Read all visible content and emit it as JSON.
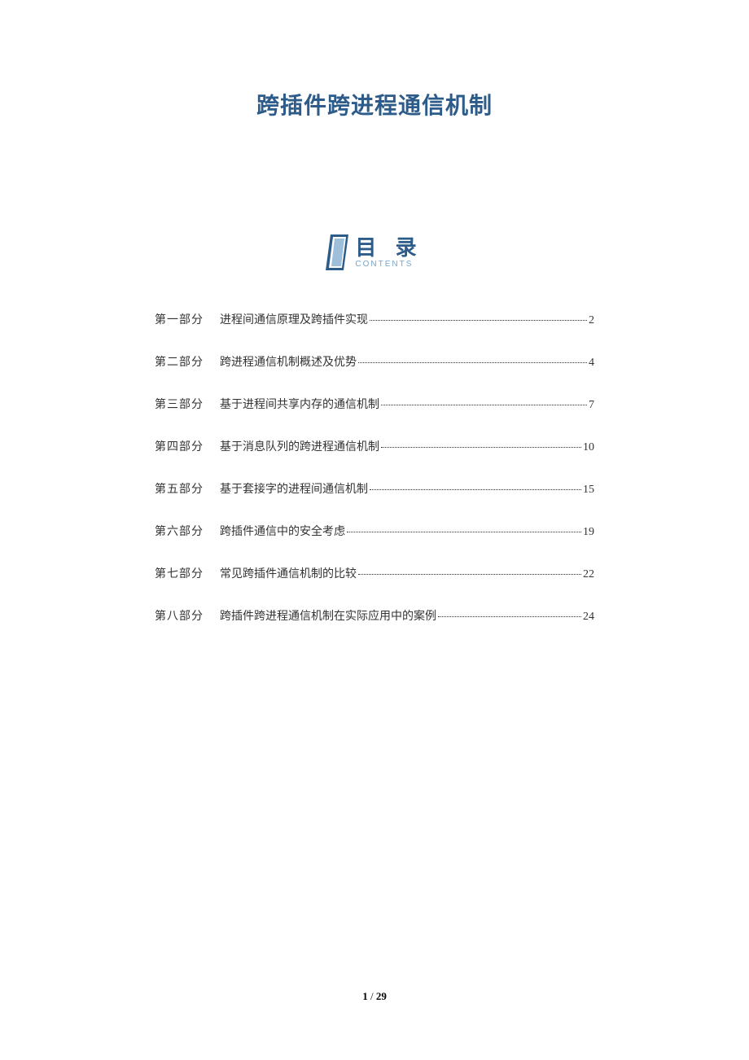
{
  "title": "跨插件跨进程通信机制",
  "toc": {
    "heading_cn": "目 录",
    "heading_en": "CONTENTS",
    "items": [
      {
        "part": "第一部分",
        "chapter": "进程间通信原理及跨插件实现",
        "page": "2"
      },
      {
        "part": "第二部分",
        "chapter": "跨进程通信机制概述及优势",
        "page": "4"
      },
      {
        "part": "第三部分",
        "chapter": "基于进程间共享内存的通信机制",
        "page": "7"
      },
      {
        "part": "第四部分",
        "chapter": "基于消息队列的跨进程通信机制",
        "page": "10"
      },
      {
        "part": "第五部分",
        "chapter": "基于套接字的进程间通信机制",
        "page": "15"
      },
      {
        "part": "第六部分",
        "chapter": "跨插件通信中的安全考虑",
        "page": "19"
      },
      {
        "part": "第七部分",
        "chapter": "常见跨插件通信机制的比较",
        "page": "22"
      },
      {
        "part": "第八部分",
        "chapter": "跨插件跨进程通信机制在实际应用中的案例",
        "page": "24"
      }
    ]
  },
  "footer": {
    "current": "1",
    "sep": " / ",
    "total": "29"
  }
}
